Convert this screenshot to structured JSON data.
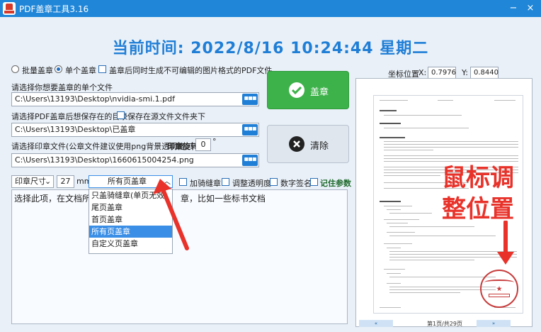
{
  "window": {
    "title": "PDF盖章工具3.16",
    "minimize": "−",
    "close": "×"
  },
  "clock": {
    "text": "当前时间:  2022/8/16 10:24:44  星期二"
  },
  "options": {
    "batch_label": "批量盖章",
    "single_label": "单个盖章",
    "image_pdf_label": "盖章后同时生成不可编辑的图片格式的PDF文件"
  },
  "file1": {
    "label": "请选择你想要盖章的单个文件",
    "value": "C:\\Users\\13193\\Desktop\\nvidia-smi.1.pdf"
  },
  "file2": {
    "label": "请选择PDF盖章后想保存在的目录",
    "save_same_label": "保存在源文件文件夹下",
    "value": "C:\\Users\\13193\\Desktop\\已盖章"
  },
  "file3": {
    "label": "请选择印章文件(公章文件建议使用png背景透明格",
    "rotate_label": "印章旋转",
    "rotate_value": "0",
    "degree": "°",
    "value": "C:\\Users\\13193\\Desktop\\1660615004254.png"
  },
  "browse_glyph": "▪▪▪",
  "buttons": {
    "stamp": "盖章",
    "clear": "清除"
  },
  "controls": {
    "size_label": "印章尺寸",
    "size_value": "27",
    "unit": "mm",
    "page_mode": "所有页盖章",
    "seam_label": "加骑缝章",
    "opacity_label": "调整透明度",
    "signature_label": "数字签名",
    "remember_label": "记住参数"
  },
  "dropdown": {
    "items": [
      "只盖骑缝章(单页无效)",
      "尾页盖章",
      "首页盖章",
      "所有页盖章",
      "自定义页盖章"
    ],
    "selected_index": 3
  },
  "hint": {
    "text_before": "选择此项，在文档所",
    "text_after": "章，比如一些标书文档"
  },
  "position": {
    "label": "坐标位置",
    "x_label": "X:",
    "x_value": "0.7976",
    "y_label": "Y:",
    "y_value": "0.8440"
  },
  "preview": {
    "annotation_line1": "鼠标调",
    "annotation_line2": "整位置",
    "page_indicator": "第1页/共29页",
    "nav_first": "«",
    "nav_next": "»"
  },
  "colors": {
    "accent": "#1f7ed6",
    "green": "#3db24a",
    "annotation": "#e8322a",
    "selection": "#3a8ee6"
  }
}
